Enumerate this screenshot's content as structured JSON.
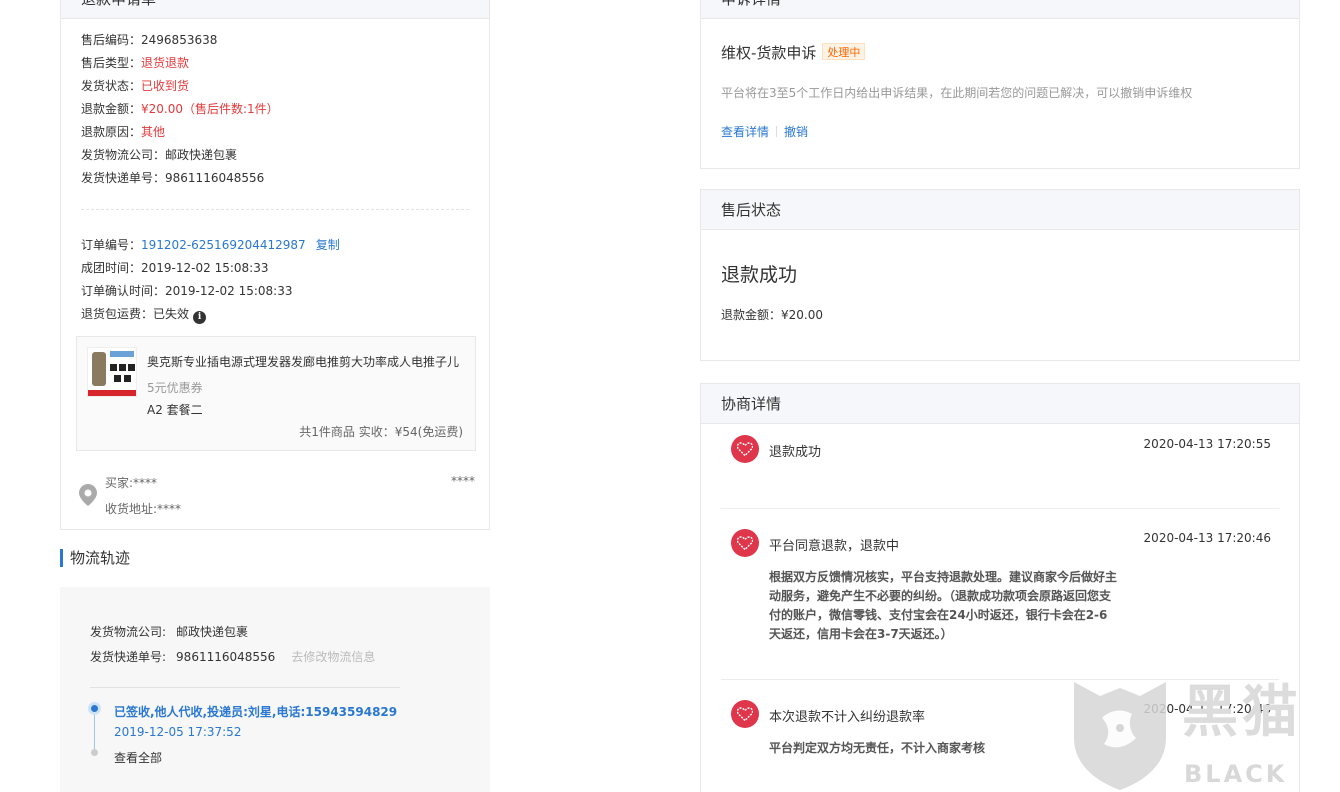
{
  "refund": {
    "header": "退款申请单",
    "after_sale_no_label": "售后编码：",
    "after_sale_no": "2496853638",
    "type_label": "售后类型：",
    "type": "退货退款",
    "ship_status_label": "发货状态：",
    "ship_status": "已收到货",
    "amount_label": "退款金额：",
    "amount": "¥20.00（售后件数:1件）",
    "reason_label": "退款原因：",
    "reason": "其他",
    "carrier_label": "发货物流公司：",
    "carrier": "邮政快递包裹",
    "tracking_label": "发货快递单号：",
    "tracking": "9861116048556",
    "order_no_label": "订单编号：",
    "order_no": "191202-625169204412987",
    "copy_label": "复制",
    "group_time_label": "成团时间：",
    "group_time": "2019-12-02 15:08:33",
    "confirm_time_label": "订单确认时间：",
    "confirm_time": "2019-12-02 15:08:33",
    "return_fee_label": "退货包运费：",
    "return_fee": "已失效",
    "info_glyph": "i",
    "product": {
      "title": "奥克斯专业插电源式理发器发廊电推剪大功率成人电推子儿",
      "coupon": "5元优惠券",
      "sku": "A2 套餐二",
      "total": "共1件商品    实收：¥54(免运费)"
    },
    "buyer_label": "买家:****",
    "buyer_right": "****",
    "address_label": "收货地址:****"
  },
  "logistics": {
    "title": "物流轨迹",
    "carrier_label": "发货物流公司:",
    "carrier": "邮政快递包裹",
    "tracking_label": "发货快递单号:",
    "tracking": "9861116048556",
    "modify_link": "去修改物流信息",
    "latest_event": "已签收,他人代收,投递员:刘星,电话:15943594829",
    "latest_time": "2019-12-05 17:37:52",
    "view_all": "查看全部"
  },
  "appeal": {
    "header": "申诉详情",
    "title": "维权-货款申诉",
    "badge": "处理中",
    "desc": "平台将在3至5个工作日内给出申诉结果，在此期间若您的问题已解决，可以撤销申诉维权",
    "view_link": "查看详情",
    "revoke_link": "撤销"
  },
  "status": {
    "header": "售后状态",
    "result": "退款成功",
    "amount": "退款金额：¥20.00"
  },
  "negotiation": {
    "header": "协商详情",
    "items": [
      {
        "title": "退款成功",
        "time": "2020-04-13 17:20:55",
        "body": ""
      },
      {
        "title": "平台同意退款，退款中",
        "time": "2020-04-13 17:20:46",
        "body": "根据双方反馈情况核实，平台支持退款处理。建议商家今后做好主动服务，避免产生不必要的纠纷。（退款成功款项会原路返回您支付的账户，微信零钱、支付宝会在24小时返还，银行卡会在2-6天返还，信用卡会在3-7天返还。）"
      },
      {
        "title": "本次退款不计入纠纷退款率",
        "time": "2020-04-13 17:20:46",
        "body": "平台判定双方均无责任，不计入商家考核"
      }
    ]
  },
  "watermark": {
    "cn": "黑猫",
    "en": "BLACK CAT"
  },
  "colors": {
    "link": "#2a78d2",
    "alert": "#e4393c",
    "badge": "#ff6600",
    "heart": "#e0364c"
  }
}
